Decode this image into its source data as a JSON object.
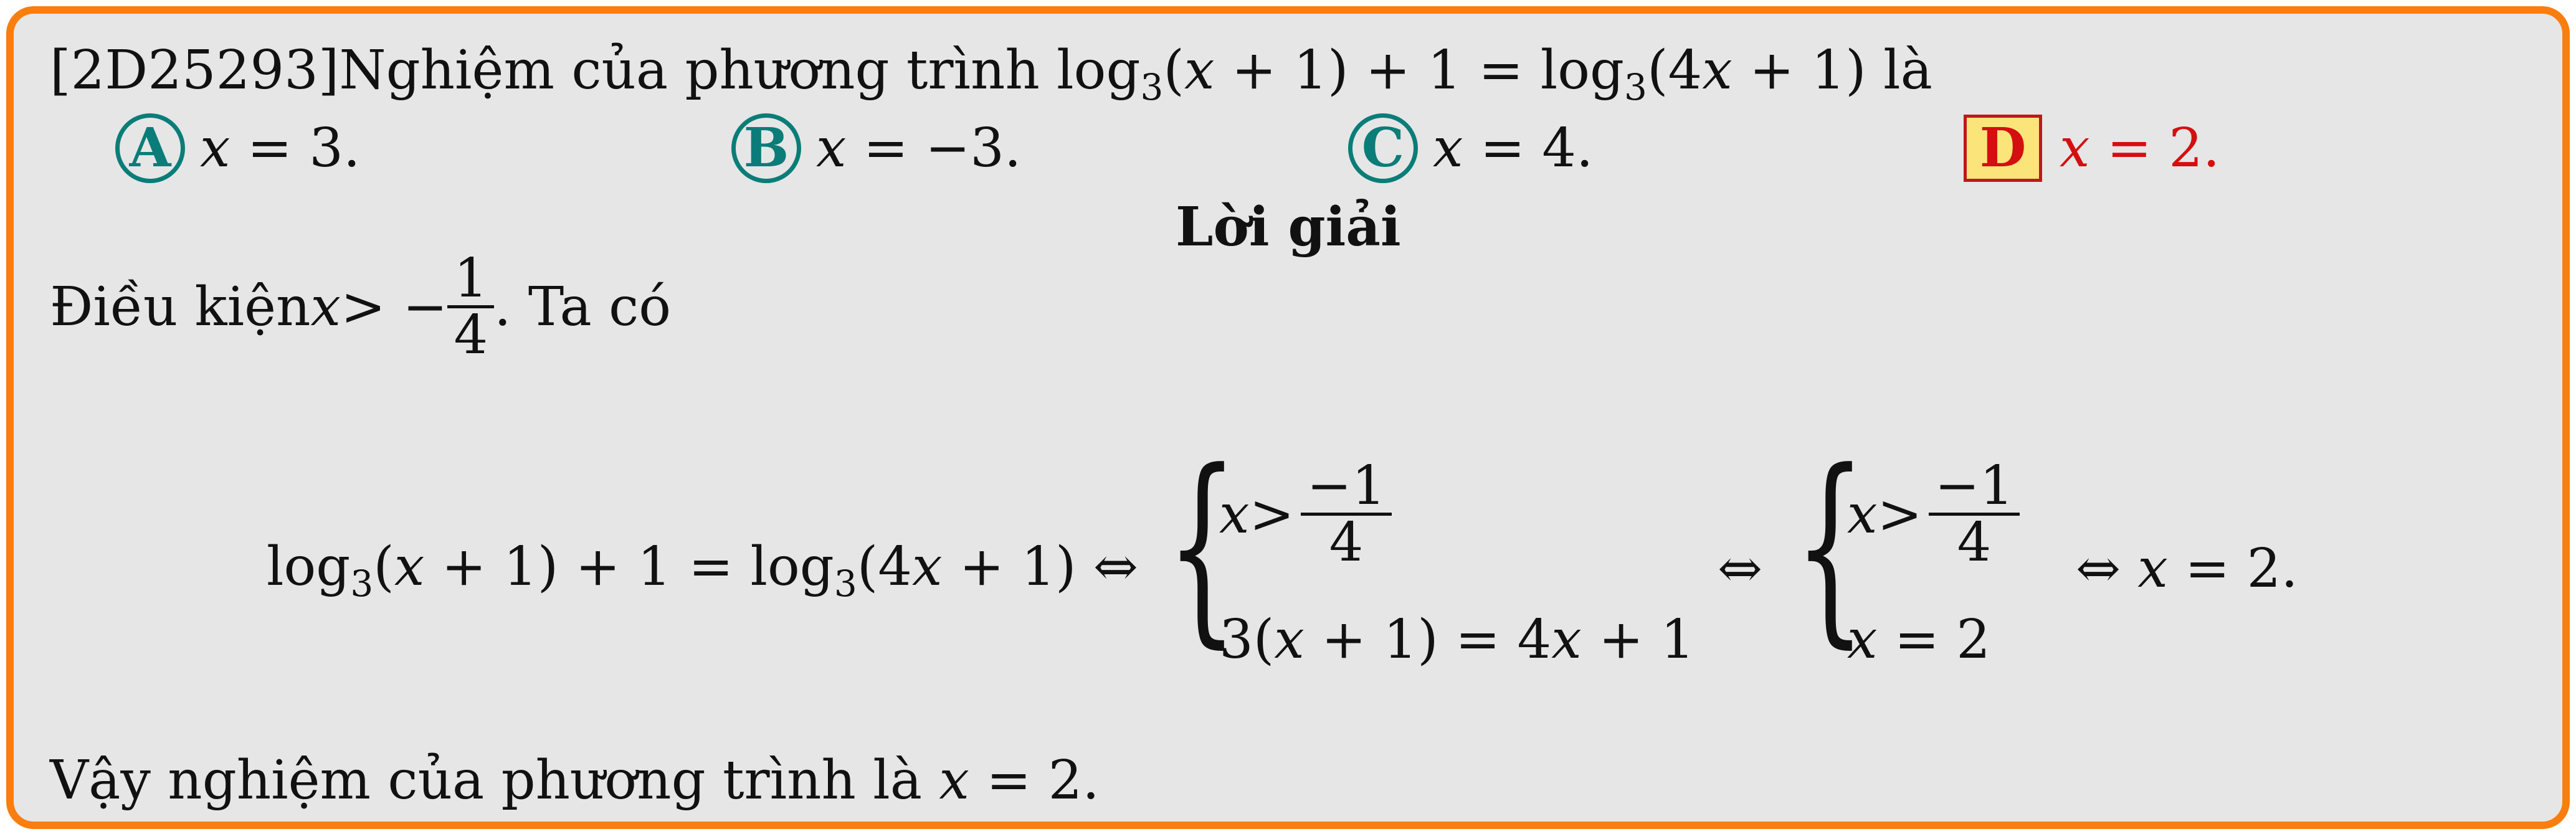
{
  "question": {
    "code": "[2D25293]",
    "text_prefix": "Nghiệm của phương trình ",
    "log": "log",
    "base": "3",
    "arg1": "(",
    "var_x": "x",
    "arg1_rest": " + 1) + 1 = ",
    "arg2_open": "(4",
    "arg2_rest": " + 1) ",
    "suffix": "là"
  },
  "options": [
    {
      "letter": "A",
      "x": "x",
      "rest": " = 3."
    },
    {
      "letter": "B",
      "x": "x",
      "rest": " = −3."
    },
    {
      "letter": "C",
      "x": "x",
      "rest": " = 4."
    },
    {
      "letter": "D",
      "x": "x",
      "rest": " = 2."
    }
  ],
  "solution": {
    "heading": "Lời giải",
    "condition_prefix": "Điều kiện ",
    "condition_rel": " > −",
    "cond_num": "1",
    "cond_den": "4",
    "condition_suffix": ". Ta có",
    "eq_lhs_a": "log",
    "eq_lhs_b": "(",
    "eq_lhs_c": " + 1) + 1 = log",
    "eq_lhs_d": "(4",
    "eq_lhs_e": " + 1) ⇔",
    "sys1_l1_rel": " > ",
    "sys_num": "−1",
    "sys_den": "4",
    "sys1_l2": "3(",
    "sys1_l2_rest": " + 1) = 4",
    "sys1_l2_end": " + 1",
    "iff": "⇔",
    "sys2_l2_rest": " = 2",
    "final": "⇔ ",
    "final_rest": " = 2.",
    "conclusion_prefix": "Vậy nghiệm của phương trình là ",
    "conclusion_rest": " = 2."
  }
}
